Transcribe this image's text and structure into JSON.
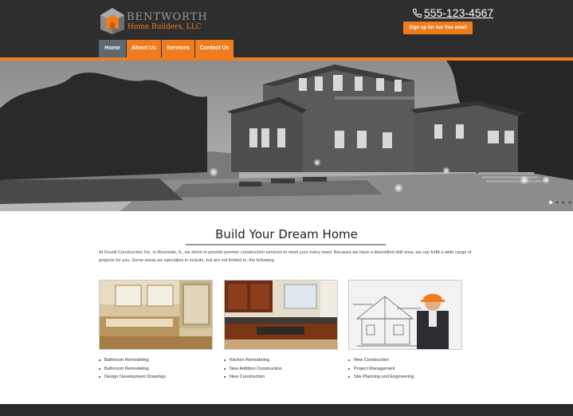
{
  "brand": {
    "name": "BENTWORTH",
    "sub": "Home Builders, LLC",
    "accent": "#f07c1e",
    "header_bg": "#2e2e2e",
    "nav_active": "#5b6a72"
  },
  "header": {
    "phone": "555-123-4567",
    "signup_label": "Sign up for our free email",
    "phone_icon": "phone-icon"
  },
  "nav": {
    "items": [
      {
        "label": "Home",
        "active": true
      },
      {
        "label": "About Us",
        "active": false
      },
      {
        "label": "Services",
        "active": false
      },
      {
        "label": "Contact Us",
        "active": false
      }
    ]
  },
  "hero": {
    "slides": 4,
    "active_slide": 1
  },
  "intro": {
    "title": "Build Your Dream Home",
    "text": "At Duvoll Construction Inc. in Riverside, IL, we strive to provide premier construction services to meet your every need. Because we have a diversified skill area, we can fulfill a wide range of projects for you. Some areas we specialize in include, but are not limited to, the following:"
  },
  "services": [
    {
      "items": [
        "Bathroom Remodeling",
        "Bathroom Remodeling",
        "Design Development Drawings"
      ]
    },
    {
      "items": [
        "Kitchen Remodeling",
        "New Addition Construction",
        "New Construction"
      ]
    },
    {
      "items": [
        "New Construction",
        "Project Management",
        "Site Planning and Engineering"
      ]
    }
  ]
}
